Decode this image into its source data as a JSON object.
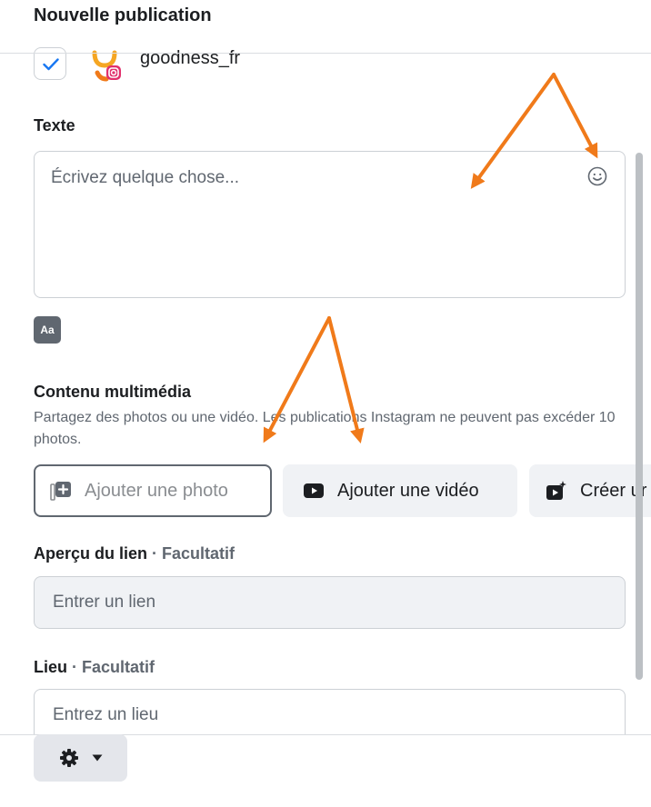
{
  "dialog": {
    "title": "Nouvelle publication"
  },
  "account": {
    "name": "goodness_fr",
    "checked": true
  },
  "text_section": {
    "label": "Texte",
    "placeholder": "Écrivez quelque chose...",
    "format_button": "Aa"
  },
  "media_section": {
    "label": "Contenu multimédia",
    "description": "Partagez des photos ou une vidéo. Les publications Instagram ne peuvent pas excéder 10 photos.",
    "add_photo": "Ajouter une photo",
    "add_video": "Ajouter une vidéo",
    "create": "Créer ur"
  },
  "link_section": {
    "label": "Aperçu du lien",
    "optional": " · Facultatif",
    "placeholder": "Entrer un lien"
  },
  "place_section": {
    "label": "Lieu",
    "optional": " · Facultatif",
    "placeholder": "Entrez un lieu"
  },
  "colors": {
    "annotation_arrow": "#f07a1a",
    "checkbox_check": "#1877f2",
    "text_primary": "#1c1e21",
    "text_secondary": "#606770"
  },
  "icons": [
    "check-icon",
    "instagram-icon",
    "emoji-icon",
    "text-format-icon",
    "photo-add-icon",
    "video-icon",
    "create-reel-icon",
    "gear-icon",
    "caret-down-icon"
  ]
}
